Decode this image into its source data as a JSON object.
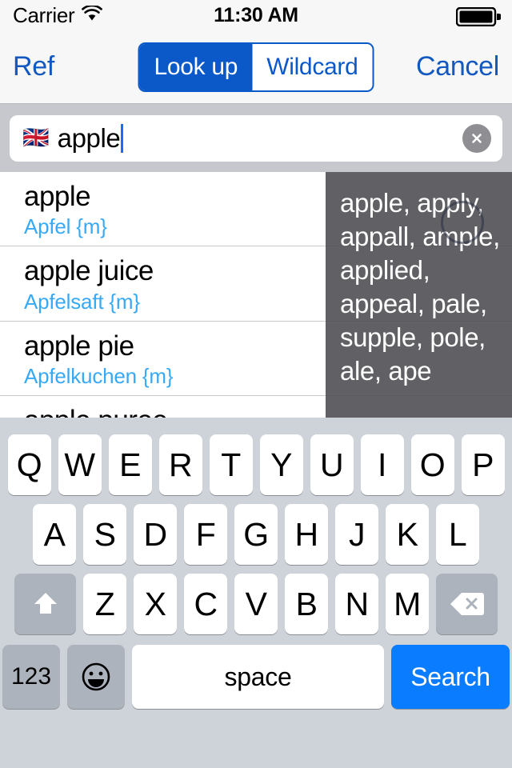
{
  "status_bar": {
    "carrier": "Carrier",
    "time": "11:30 AM",
    "wifi_icon": "wifi-icon",
    "battery_icon": "battery-full-icon"
  },
  "nav_bar": {
    "left_button": "Ref",
    "right_button": "Cancel",
    "segments": [
      {
        "label": "Look up",
        "selected": true
      },
      {
        "label": "Wildcard",
        "selected": false
      }
    ]
  },
  "search": {
    "flag_icon": "uk-flag-icon",
    "flag_glyph": "🇬🇧",
    "value": "apple",
    "clear_icon": "clear-circle-icon"
  },
  "results": [
    {
      "term": "apple",
      "translation": "Apfel {m}"
    },
    {
      "term": "apple juice",
      "translation": "Apfelsaft {m}"
    },
    {
      "term": "apple pie",
      "translation": "Apfelkuchen {m}"
    },
    {
      "term": "apple puree",
      "translation": ""
    }
  ],
  "suggestion_overlay": {
    "text": "apple, apply, appall, ample, applied, appeal, pale, supple, pole, ale, ape",
    "activity_icon": "activity-indicator-icon"
  },
  "keyboard": {
    "row1": [
      "Q",
      "W",
      "E",
      "R",
      "T",
      "Y",
      "U",
      "I",
      "O",
      "P"
    ],
    "row2": [
      "A",
      "S",
      "D",
      "F",
      "G",
      "H",
      "J",
      "K",
      "L"
    ],
    "row3": [
      "Z",
      "X",
      "C",
      "V",
      "B",
      "N",
      "M"
    ],
    "shift_icon": "shift-arrow-icon",
    "delete_icon": "backspace-icon",
    "numbers_label": "123",
    "emoji_icon": "smiley-face-icon",
    "space_label": "space",
    "search_label": "Search"
  },
  "colors": {
    "nav_blue": "#1258c0",
    "segment_blue": "#0b59c8",
    "translation_blue": "#38a9f5",
    "search_key_blue": "#0a7cff",
    "keyboard_bg": "#ced2d9",
    "overlay_gray": "#4b4b50"
  }
}
